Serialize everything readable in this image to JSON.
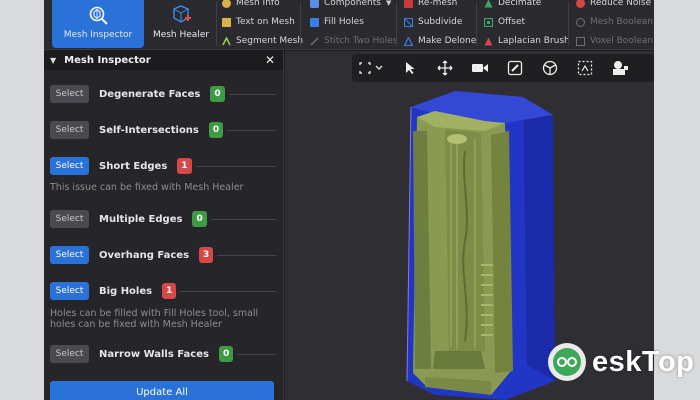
{
  "ribbon": {
    "big_buttons": [
      {
        "label": "Mesh Inspector",
        "icon": "mesh-inspector-icon"
      },
      {
        "label": "Mesh Healer",
        "icon": "mesh-healer-icon"
      }
    ],
    "columns": [
      [
        {
          "label": "Mesh Info",
          "icon": "info-icon",
          "enabled": true
        },
        {
          "label": "Text on Mesh",
          "icon": "text-icon",
          "enabled": true
        },
        {
          "label": "Segment Mesh",
          "icon": "segment-icon",
          "enabled": true
        }
      ],
      [
        {
          "label": "Components",
          "icon": "components-icon",
          "enabled": true
        },
        {
          "label": "Fill Holes",
          "icon": "fill-holes-icon",
          "enabled": true
        },
        {
          "label": "Stitch Two Holes",
          "icon": "stitch-icon",
          "enabled": false
        }
      ],
      [
        {
          "label": "Re-mesh",
          "icon": "remesh-icon",
          "enabled": true
        },
        {
          "label": "Subdivide",
          "icon": "subdivide-icon",
          "enabled": true
        },
        {
          "label": "Make Delone",
          "icon": "delone-icon",
          "enabled": true
        }
      ],
      [
        {
          "label": "Decimate",
          "icon": "decimate-icon",
          "enabled": true
        },
        {
          "label": "Offset",
          "icon": "offset-icon",
          "enabled": true
        },
        {
          "label": "Laplacian Brush",
          "icon": "brush-icon",
          "enabled": true
        }
      ],
      [
        {
          "label": "Reduce Noise",
          "icon": "noise-icon",
          "enabled": true
        },
        {
          "label": "Mesh Boolean",
          "icon": "boolean-icon",
          "enabled": false
        },
        {
          "label": "Voxel Boolean",
          "icon": "voxel-icon",
          "enabled": false
        }
      ]
    ]
  },
  "panel": {
    "title": "Mesh Inspector",
    "select_label": "Select",
    "issues": [
      {
        "label": "Degenerate Faces",
        "count": "0",
        "status": "ok",
        "selected": false
      },
      {
        "label": "Self-Intersections",
        "count": "0",
        "status": "ok",
        "selected": false
      },
      {
        "label": "Short Edges",
        "count": "1",
        "status": "bad",
        "selected": true
      },
      {
        "label": "Multiple Edges",
        "count": "0",
        "status": "ok",
        "selected": false
      },
      {
        "label": "Overhang Faces",
        "count": "3",
        "status": "bad",
        "selected": true
      },
      {
        "label": "Big Holes",
        "count": "1",
        "status": "bad",
        "selected": true
      },
      {
        "label": "Narrow Walls Faces",
        "count": "0",
        "status": "ok",
        "selected": false
      }
    ],
    "notes": [
      "This issue can be fixed with Mesh Healer",
      "Holes can be filled with Fill Holes tool, small holes can be fixed with Mesh Healer"
    ],
    "update_label": "Update All"
  },
  "viewport": {
    "tools": [
      "selection-box-icon",
      "pointer-icon",
      "move-icon",
      "camera-icon",
      "edit-icon",
      "steering-icon",
      "select-region-icon",
      "stamp-icon"
    ]
  },
  "colors": {
    "accent": "#2a71d8",
    "ok": "#3e9a45",
    "bad": "#d64848",
    "mesh_outer": "#2437c9",
    "mesh_inner": "#8b9a55"
  },
  "watermark": {
    "text": "eskTop"
  }
}
